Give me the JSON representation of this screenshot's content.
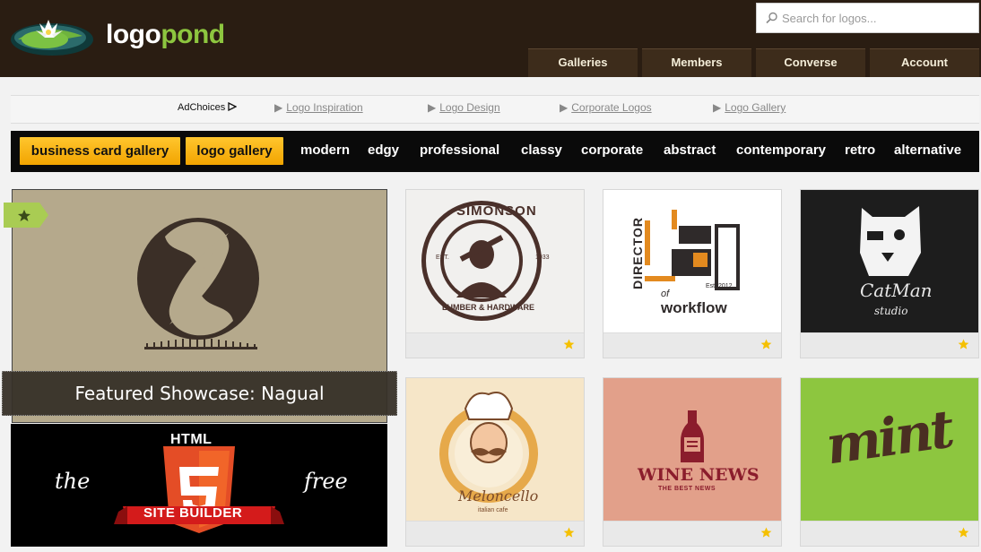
{
  "header": {
    "logo": {
      "word_part1": "logo",
      "word_part2": "pond",
      "icon": "lily-pad-icon"
    },
    "search": {
      "placeholder": "Search for logos...",
      "icon": "search-icon"
    },
    "nav": [
      {
        "label": "Galleries"
      },
      {
        "label": "Members"
      },
      {
        "label": "Converse"
      },
      {
        "label": "Account"
      }
    ]
  },
  "adbar": {
    "adchoices": "AdChoices",
    "links": [
      "Logo Inspiration",
      "Logo Design",
      "Corporate Logos",
      "Logo Gallery"
    ]
  },
  "tagbar": {
    "highlight": [
      "business card gallery",
      "logo gallery"
    ],
    "tags": [
      "modern",
      "edgy",
      "professional",
      "classy",
      "corporate",
      "abstract",
      "contemporary",
      "retro",
      "alternative"
    ]
  },
  "featured": {
    "caption": "Featured Showcase: Nagual",
    "ribbon_icon": "star-icon"
  },
  "promo": {
    "left_word": "the",
    "right_word": "free",
    "badge_top": "HTML",
    "badge_number": "5",
    "badge_banner": "SITE BUILDER"
  },
  "thumbnails": [
    {
      "top": "SIMONSON",
      "bottom": "LUMBER & HARDWARE",
      "left_small": "EST.",
      "right_small": "1933"
    },
    {
      "word1": "DIRECTOR",
      "word2": "of",
      "word3": "workflow",
      "small": "Est. 2012"
    },
    {
      "word1": "CatMan",
      "word2": "studio"
    },
    {
      "word1": "Meloncello",
      "word2": "italian cafe"
    },
    {
      "word1": "WINE NEWS",
      "word2": "THE BEST NEWS"
    },
    {
      "word1": "mint"
    }
  ],
  "colors": {
    "header_bg": "#2a1d12",
    "nav_bg": "#3d2c1b",
    "accent_green": "#8dc63f",
    "tag_yellow": "#f2a400",
    "star_yellow": "#f5c000"
  }
}
